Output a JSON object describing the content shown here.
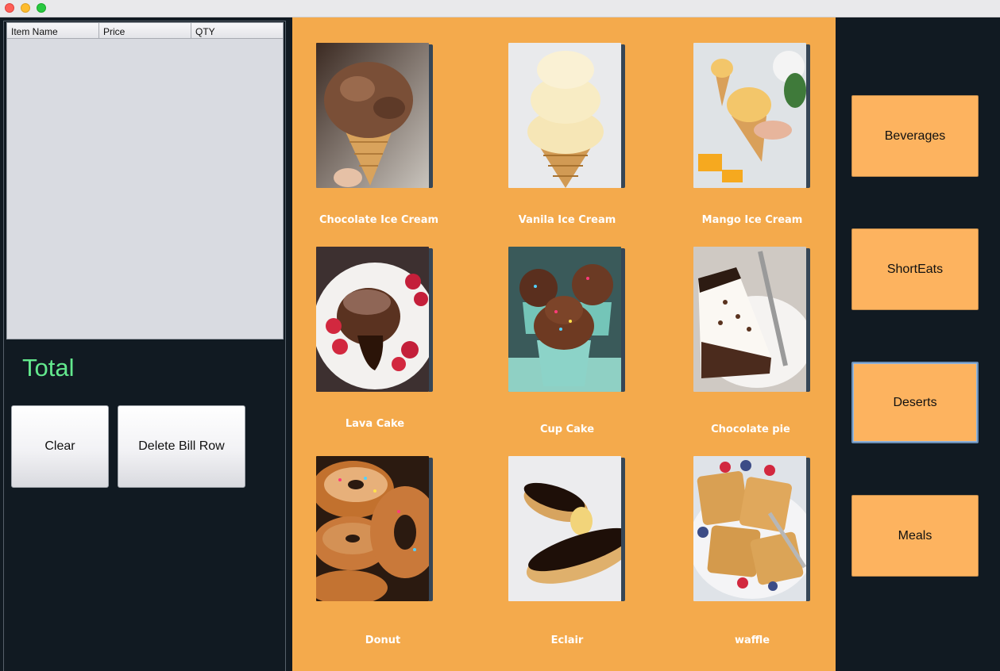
{
  "bill": {
    "columns": [
      "Item Name",
      "Price",
      "QTY"
    ],
    "rows": []
  },
  "total_label": "Total",
  "buttons": {
    "clear": "Clear",
    "delete": "Delete Bill Row"
  },
  "menu_items": [
    {
      "label": "Chocolate Ice Cream",
      "icon": "chocolate-ice-cream-image"
    },
    {
      "label": "Vanila Ice Cream",
      "icon": "vanilla-ice-cream-image"
    },
    {
      "label": "Mango Ice Cream",
      "icon": "mango-ice-cream-image"
    },
    {
      "label": "Lava Cake",
      "icon": "lava-cake-image"
    },
    {
      "label": "Cup Cake",
      "icon": "cupcake-image"
    },
    {
      "label": "Chocolate pie",
      "icon": "chocolate-pie-image"
    },
    {
      "label": "Donut",
      "icon": "donut-image"
    },
    {
      "label": "Eclair",
      "icon": "eclair-image"
    },
    {
      "label": "waffle",
      "icon": "waffle-image"
    }
  ],
  "categories": [
    {
      "label": "Beverages",
      "active": false
    },
    {
      "label": "ShortEats",
      "active": false
    },
    {
      "label": "Deserts",
      "active": true
    },
    {
      "label": "Meals",
      "active": false
    }
  ],
  "colors": {
    "menu_bg": "#f4aa4c",
    "category_button": "#fdb35f",
    "total_text": "#63e88d",
    "dark_bg": "#111a22"
  }
}
